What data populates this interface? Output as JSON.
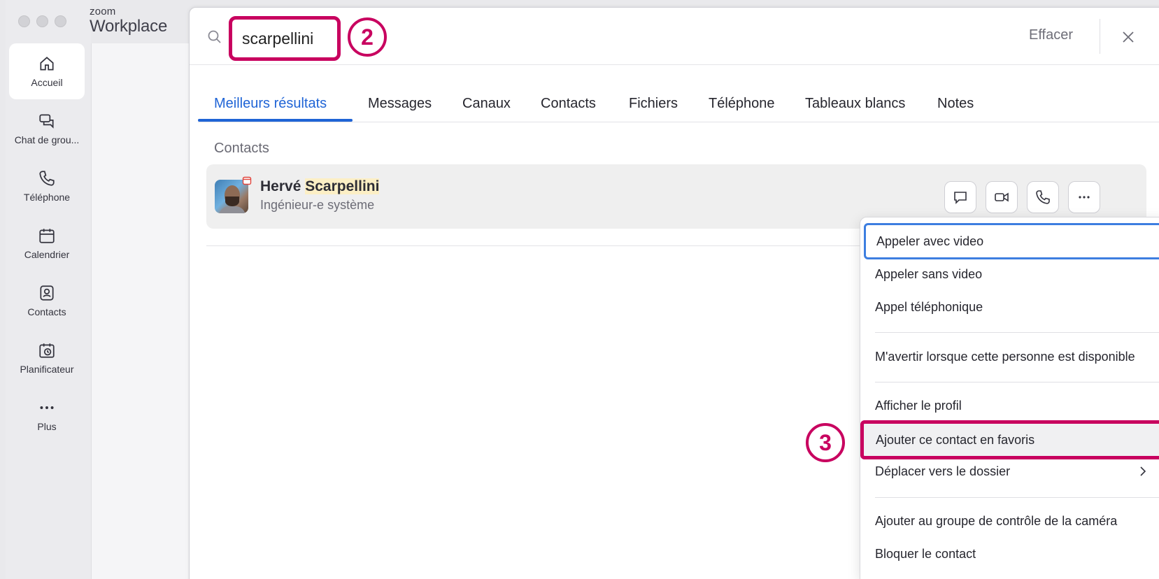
{
  "app": {
    "brand_small": "zoom",
    "brand_big": "Workplace"
  },
  "nav": {
    "items": [
      {
        "label": "Accueil",
        "icon": "home-icon",
        "active": true
      },
      {
        "label": "Chat de grou...",
        "icon": "chat-icon",
        "active": false
      },
      {
        "label": "Téléphone",
        "icon": "phone-icon",
        "active": false
      },
      {
        "label": "Calendrier",
        "icon": "calendar-icon",
        "active": false
      },
      {
        "label": "Contacts",
        "icon": "contacts-icon",
        "active": false
      },
      {
        "label": "Planificateur",
        "icon": "scheduler-icon",
        "active": false
      },
      {
        "label": "Plus",
        "icon": "more-icon",
        "active": false
      }
    ]
  },
  "search": {
    "value": "scarpellini",
    "clear_label": "Effacer",
    "callout_search": "2",
    "callout_menu": "3"
  },
  "tabs": [
    {
      "label": "Meilleurs résultats",
      "active": true
    },
    {
      "label": "Messages",
      "active": false
    },
    {
      "label": "Canaux",
      "active": false
    },
    {
      "label": "Contacts",
      "active": false
    },
    {
      "label": "Fichiers",
      "active": false
    },
    {
      "label": "Téléphone",
      "active": false
    },
    {
      "label": "Tableaux blancs",
      "active": false
    },
    {
      "label": "Notes",
      "active": false
    }
  ],
  "results": {
    "section_title": "Contacts",
    "contact": {
      "first_name": "Hervé",
      "last_name": "Scarpellini",
      "role": "Ingénieur-e système"
    }
  },
  "menu": {
    "items": [
      {
        "label": "Appeler avec video"
      },
      {
        "label": "Appeler sans video"
      },
      {
        "label": "Appel téléphonique"
      },
      {
        "label": "M'avertir lorsque cette personne est disponible"
      },
      {
        "label": "Afficher le profil"
      },
      {
        "label": "Ajouter ce contact en favoris"
      },
      {
        "label": "Déplacer vers le dossier"
      },
      {
        "label": "Ajouter au groupe de contrôle de la caméra"
      },
      {
        "label": "Bloquer le contact"
      }
    ]
  },
  "colors": {
    "accent": "#1f64d6",
    "callout": "#c8005f",
    "highlight": "#fcefc5"
  }
}
